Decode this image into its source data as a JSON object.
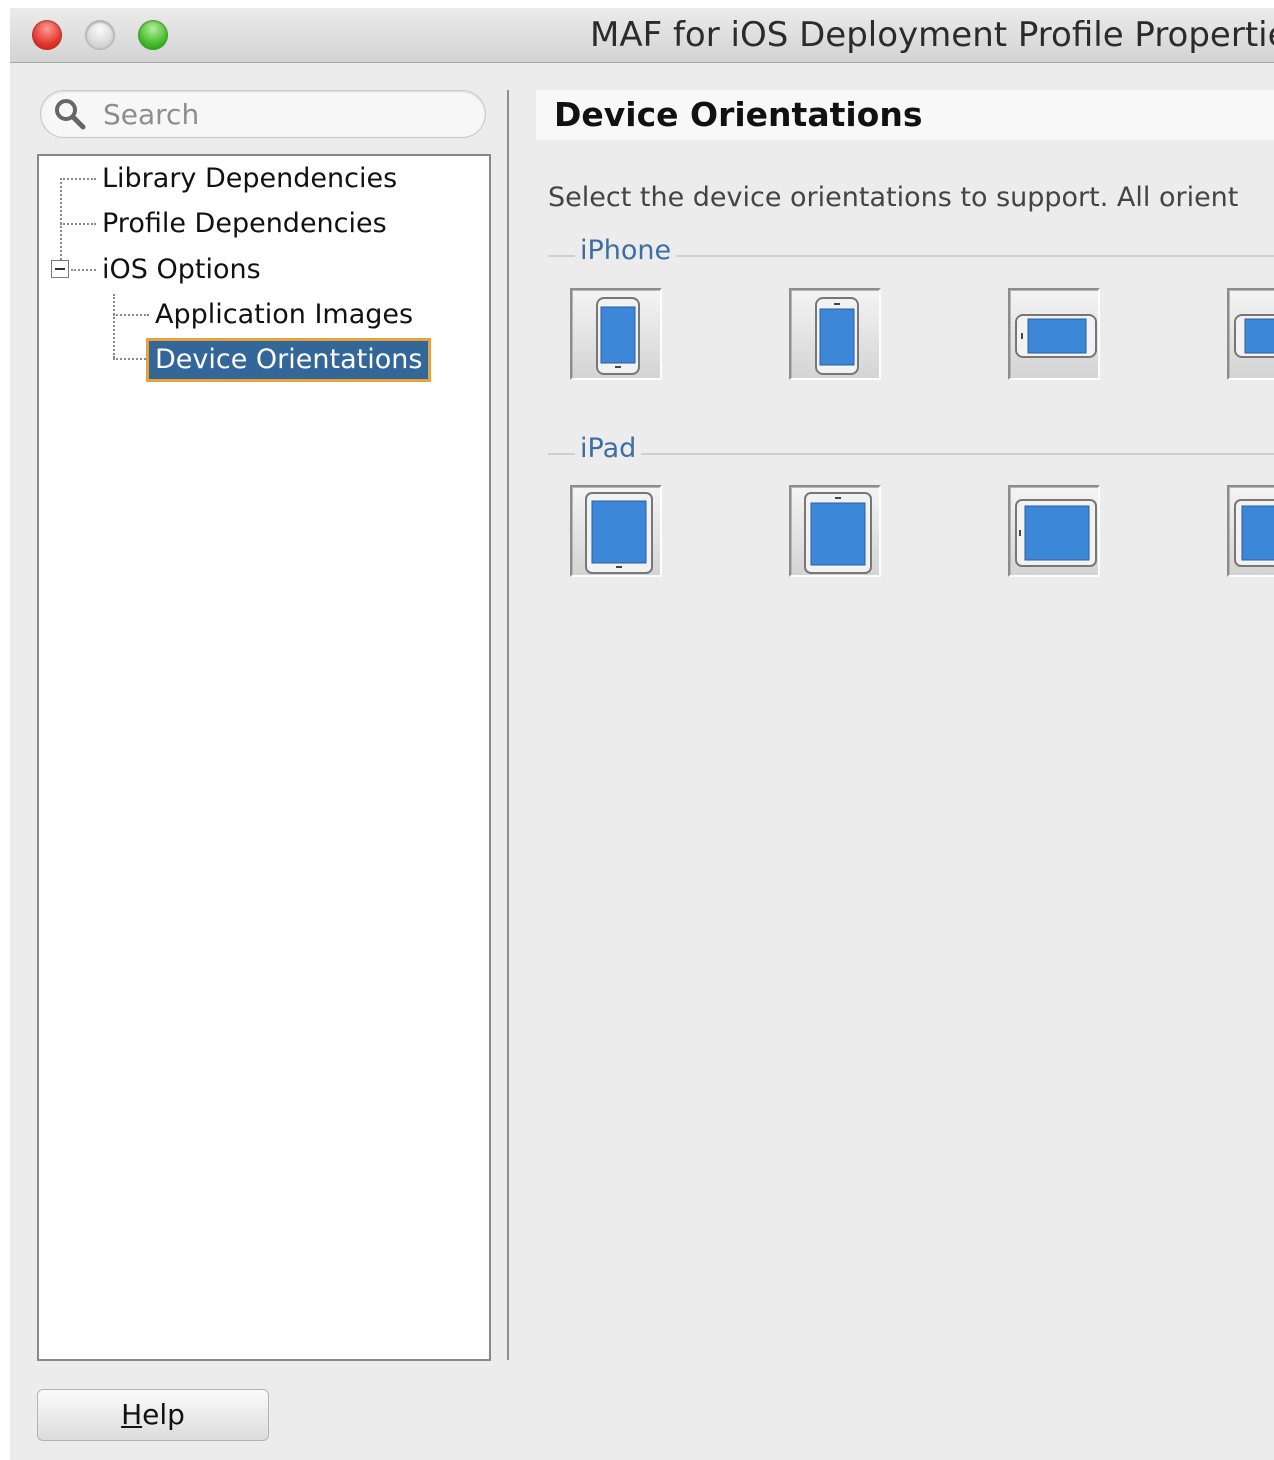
{
  "window": {
    "title": "MAF for iOS Deployment Profile Propertie"
  },
  "search": {
    "placeholder": "Search"
  },
  "tree": {
    "items": [
      {
        "label": "Library Dependencies"
      },
      {
        "label": "Profile Dependencies"
      },
      {
        "label": "iOS Options",
        "expanded": true
      },
      {
        "label": "Application Images"
      },
      {
        "label": "Device Orientations",
        "selected": true
      }
    ]
  },
  "main": {
    "section_title": "Device Orientations",
    "description": "Select the device orientations to support. All orient",
    "groups": {
      "iphone": {
        "label": "iPhone",
        "orientation_icons": [
          "portrait-icon",
          "portrait-upside-down-icon",
          "landscape-left-icon",
          "landscape-right-icon"
        ]
      },
      "ipad": {
        "label": "iPad",
        "orientation_icons": [
          "portrait-icon",
          "portrait-upside-down-icon",
          "landscape-left-icon",
          "landscape-right-icon"
        ]
      }
    }
  },
  "footer": {
    "help_mnemonic": "H",
    "help_rest": "elp"
  },
  "colors": {
    "selection_bg": "#336699",
    "selection_outline": "#e7a33a",
    "group_label": "#3c6ea5",
    "screen_blue": "#3d87d9"
  }
}
